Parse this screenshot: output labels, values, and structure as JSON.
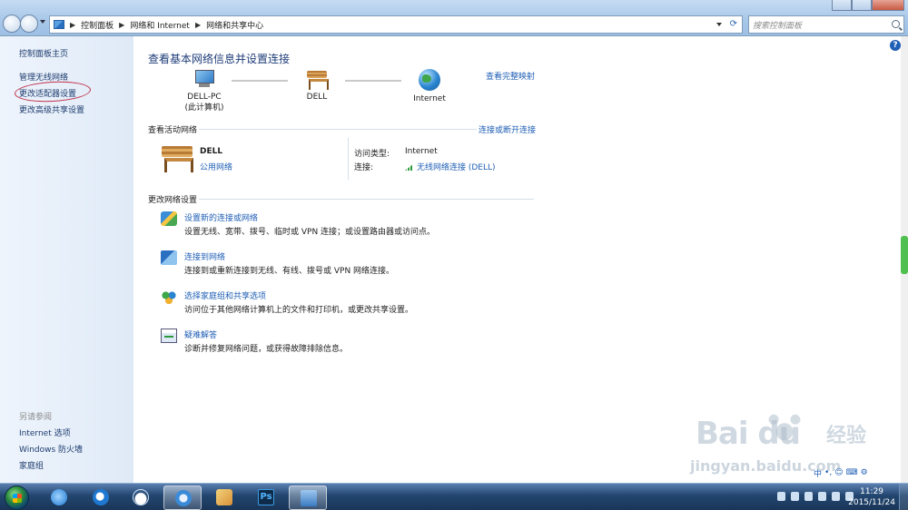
{
  "address": {
    "breadcrumbs": [
      "控制面板",
      "网络和 Internet",
      "网络和共享中心"
    ],
    "search_placeholder": "搜索控制面板"
  },
  "sidebar": {
    "home": "控制面板主页",
    "links": [
      "管理无线网络",
      "更改适配器设置",
      "更改高级共享设置"
    ],
    "see_also_label": "另请参阅",
    "see_also": [
      "Internet 选项",
      "Windows 防火墙",
      "家庭组"
    ]
  },
  "main": {
    "title": "查看基本网络信息并设置连接",
    "map_link": "查看完整映射",
    "nodes": {
      "pc_name": "DELL-PC",
      "pc_sub": "(此计算机)",
      "network": "DELL",
      "internet": "Internet"
    },
    "active_heading": "查看活动网络",
    "connect_link": "连接或断开连接",
    "active_network": {
      "name": "DELL",
      "type": "公用网络",
      "access_label": "访问类型:",
      "access_value": "Internet",
      "conn_label": "连接:",
      "conn_value": "无线网络连接 (DELL)"
    },
    "change_heading": "更改网络设置",
    "tasks": [
      {
        "title": "设置新的连接或网络",
        "desc": "设置无线、宽带、拨号、临时或 VPN 连接；或设置路由器或访问点。"
      },
      {
        "title": "连接到网络",
        "desc": "连接到或重新连接到无线、有线、拨号或 VPN 网络连接。"
      },
      {
        "title": "选择家庭组和共享选项",
        "desc": "访问位于其他网络计算机上的文件和打印机，或更改共享设置。"
      },
      {
        "title": "疑难解答",
        "desc": "诊断并修复网络问题，或获得故障排除信息。"
      }
    ]
  },
  "ime": {
    "lang": "中"
  },
  "watermark": {
    "logo": "Bai du",
    "brand": "经验",
    "url": "jingyan.baidu.com"
  },
  "taskbar": {
    "time": "11:29",
    "date": "2015/11/24",
    "ps_label": "Ps"
  },
  "colors": {
    "link": "#1f5fb5",
    "title": "#1e3c78",
    "annotation": "#c0314a"
  }
}
